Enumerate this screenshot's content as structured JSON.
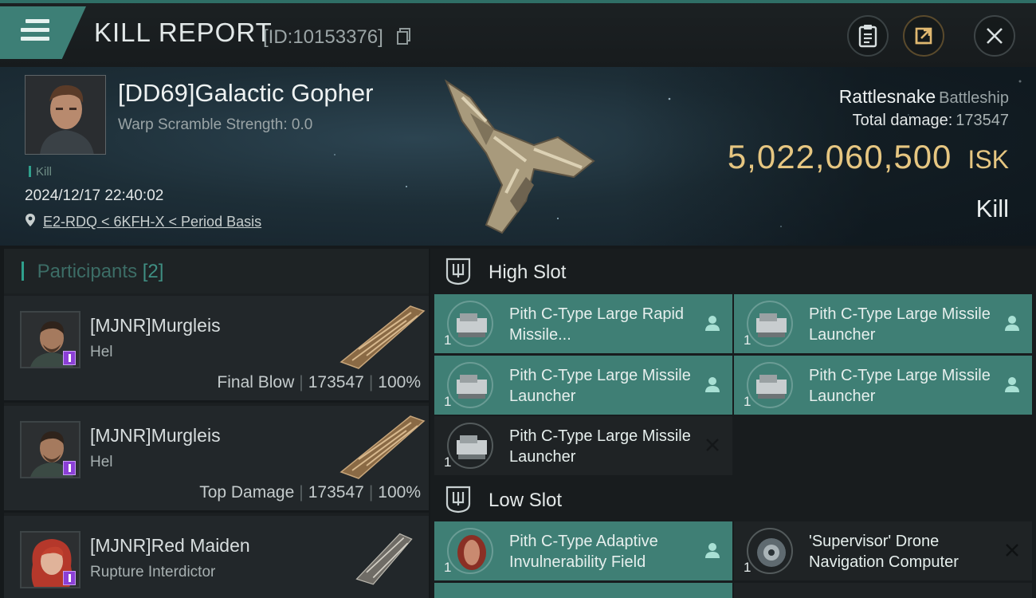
{
  "header": {
    "title": "KILL REPORT",
    "report_id": "[ID:10153376]"
  },
  "victim": {
    "name": "[DD69]Galactic Gopher",
    "warp_scramble": "Warp Scramble Strength: 0.0",
    "tag": "Kill",
    "datetime": "2024/12/17 22:40:02",
    "location": "E2-RDQ < 6KFH-X < Period Basis",
    "ship_name": "Rattlesnake",
    "ship_class": "Battleship",
    "damage_label": "Total damage:",
    "damage_value": "173547",
    "isk_value": "5,022,060,500",
    "isk_unit": "ISK",
    "result": "Kill"
  },
  "participants": {
    "title": "Participants",
    "count": "[2]",
    "rows": [
      {
        "name": "[MJNR]Murgleis",
        "ship": "Hel",
        "role": "Final Blow",
        "damage": "173547",
        "percent": "100%"
      },
      {
        "name": "[MJNR]Murgleis",
        "ship": "Hel",
        "role": "Top Damage",
        "damage": "173547",
        "percent": "100%"
      },
      {
        "name": "[MJNR]Red Maiden",
        "ship": "Rupture Interdictor"
      }
    ]
  },
  "fitting": {
    "high_slot_title": "High Slot",
    "low_slot_title": "Low Slot",
    "high": [
      {
        "name": "Pith C-Type Large Rapid Missile...",
        "qty": "1",
        "status": "person-icon"
      },
      {
        "name": "Pith C-Type Large Missile Launcher",
        "qty": "1",
        "status": "person-icon"
      },
      {
        "name": "Pith C-Type Large Missile Launcher",
        "qty": "1",
        "status": "person-icon"
      },
      {
        "name": "Pith C-Type Large Missile Launcher",
        "qty": "1",
        "status": "person-icon"
      },
      {
        "name": "Pith C-Type Large Missile Launcher",
        "qty": "1",
        "status": "destroyed-x-icon"
      }
    ],
    "low": [
      {
        "name": "Pith C-Type Adaptive Invulnerability Field",
        "qty": "1",
        "status": "person-icon"
      },
      {
        "name": "'Supervisor' Drone Navigation Computer",
        "qty": "1",
        "status": "destroyed-x-icon"
      }
    ]
  },
  "colors": {
    "accent_teal": "#3f7f75",
    "isk_gold": "#e6c681",
    "purple_badge": "#8b3fd6"
  }
}
